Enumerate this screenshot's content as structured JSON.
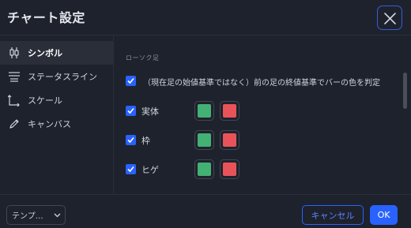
{
  "dialog": {
    "title": "チャート設定",
    "close_icon": "close-icon"
  },
  "sidebar": {
    "items": [
      {
        "label": "シンボル",
        "icon": "candles-icon",
        "active": true
      },
      {
        "label": "ステータスライン",
        "icon": "status-line-icon",
        "active": false
      },
      {
        "label": "スケール",
        "icon": "scales-icon",
        "active": false
      },
      {
        "label": "キャンバス",
        "icon": "pencil-icon",
        "active": false
      }
    ]
  },
  "content": {
    "section_title": "ローソク足",
    "rows": [
      {
        "label": "（現在足の始値基準ではなく）前の足の終値基準でバーの色を判定",
        "checked": true
      },
      {
        "label": "実体",
        "checked": true,
        "up_color": "#43b074",
        "down_color": "#e8535a"
      },
      {
        "label": "枠",
        "checked": true,
        "up_color": "#43b074",
        "down_color": "#e8535a"
      },
      {
        "label": "ヒゲ",
        "checked": true,
        "up_color": "#43b074",
        "down_color": "#e8535a"
      }
    ]
  },
  "footer": {
    "template_label": "テンプ…",
    "cancel_label": "キャンセル",
    "ok_label": "OK"
  },
  "colors": {
    "accent": "#2962ff",
    "background": "#1e222d"
  }
}
